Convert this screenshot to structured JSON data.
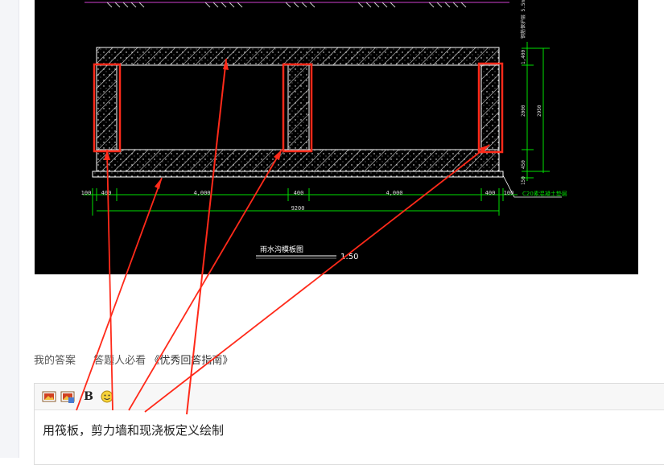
{
  "drawing": {
    "dim_labels_bottom": [
      "100",
      "400",
      "4,000",
      "400",
      "4,000",
      "400",
      "100"
    ],
    "dim_total": "9200",
    "dim_right": [
      "1,400",
      "2000",
      "2950",
      "450",
      "150"
    ],
    "top_note": "钢筋保护层 5.5m",
    "side_note": "C20素混凝土垫层",
    "title": "雨水沟模板图",
    "scale": "1:50"
  },
  "answer_bar": {
    "my_answer": "我的答案",
    "guide_prefix": "答题人必看",
    "guide_link": "《优秀回答指南》"
  },
  "editor": {
    "toolbar": {
      "image_icon": "image-icon",
      "image_upload_icon": "image-upload-icon",
      "bold_label": "B",
      "emoji_icon": "emoji-icon"
    },
    "content": "用筏板，剪力墙和现浇板定义绘制"
  },
  "colors": {
    "annotation": "#ff2a1a",
    "cad_dimension": "#00e000",
    "cad_background": "#000000"
  }
}
